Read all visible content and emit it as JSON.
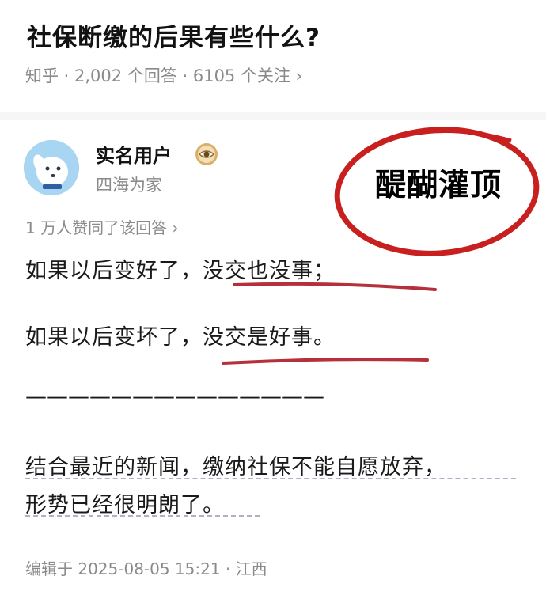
{
  "question": {
    "title": "社保断缴的后果有些什么?",
    "meta": "知乎 · 2,002 个回答 · 6105 个关注 ›"
  },
  "author": {
    "name": "实名用户",
    "subtitle": "四海为家",
    "avatar_icon": "dog-avatar-icon",
    "badge_icon": "eye-badge-icon"
  },
  "answer": {
    "upvotes": "1 万人赞同了该回答 ›",
    "line1": "如果以后变好了，没交也没事；",
    "line2": "如果以后变坏了，没交是好事。",
    "dashes": "——————————————",
    "para_line1": "结合最近的新闻，缴纳社保不能自愿放弃，",
    "para_line2": "形势已经很明朗了。",
    "edited": "编辑于 2025-08-05 15:21 · 江西"
  },
  "stamp": {
    "text": "醍醐灌顶",
    "color": "#c8201f"
  },
  "colors": {
    "underline_red": "#b5303a",
    "meta_gray": "#8a8a8a"
  }
}
